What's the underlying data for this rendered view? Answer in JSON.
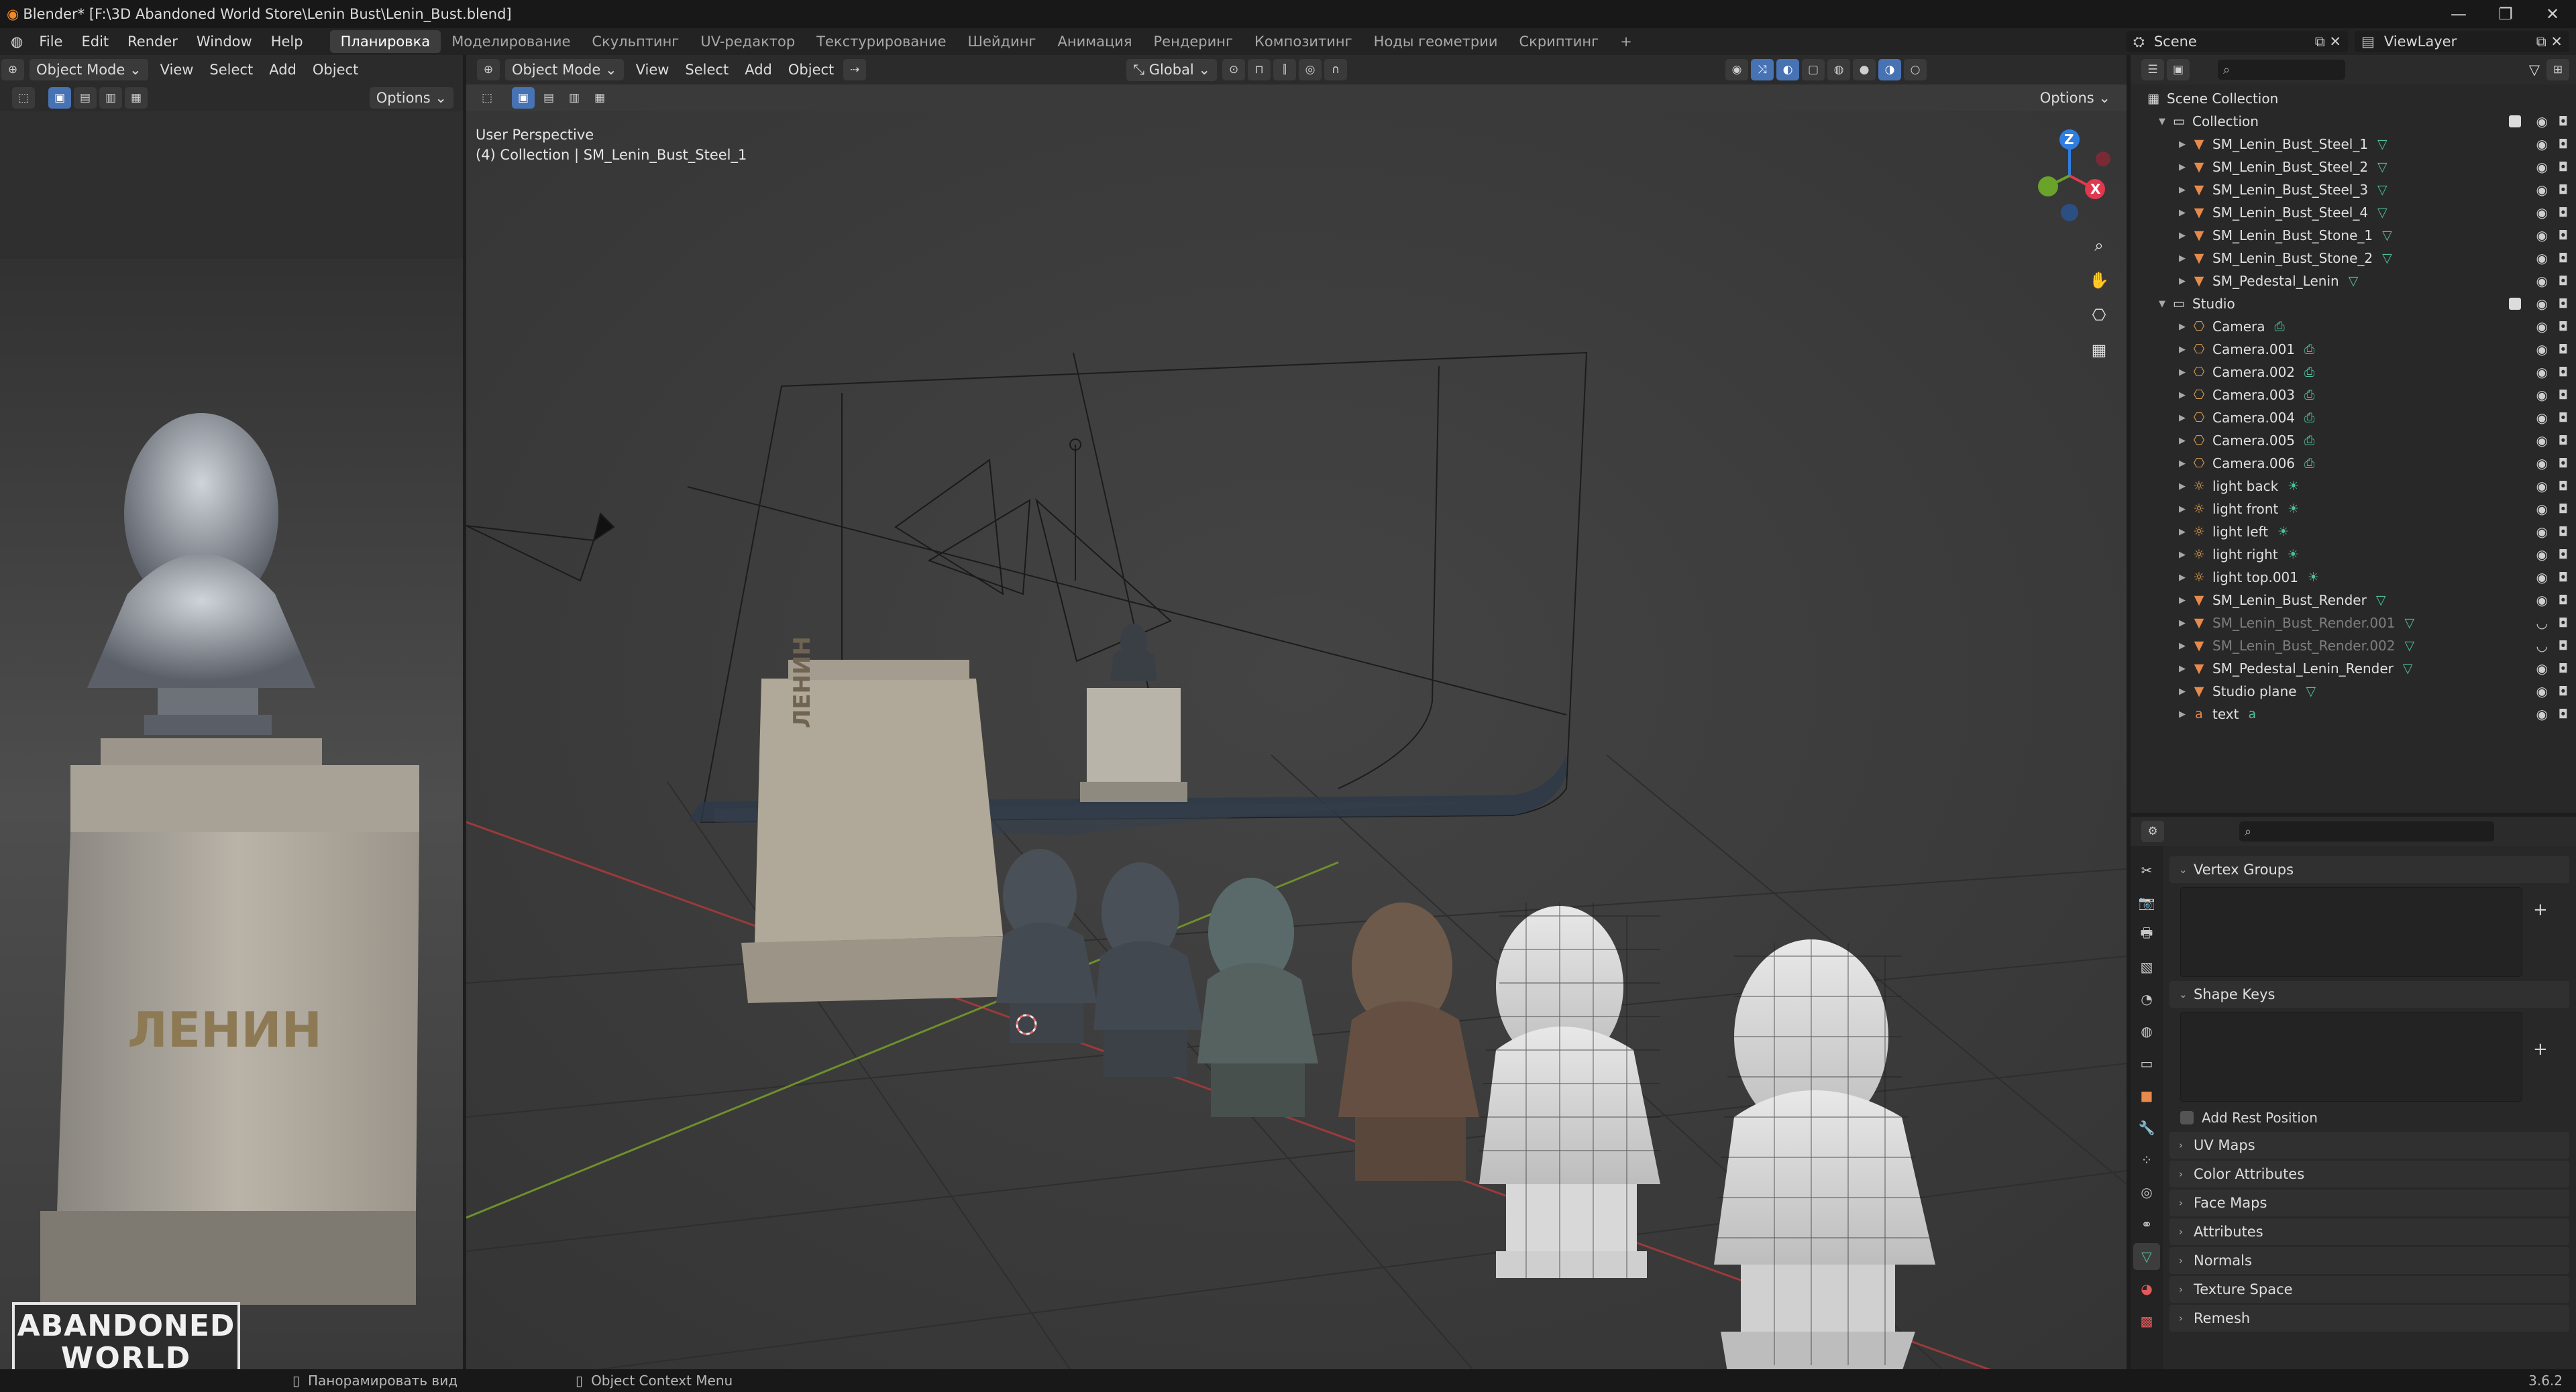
{
  "window": {
    "title": "Blender* [F:\\3D Abandoned World Store\\Lenin Bust\\Lenin_Bust.blend]",
    "controls": [
      "—",
      "❐",
      "✕"
    ]
  },
  "menu": {
    "items": [
      "File",
      "Edit",
      "Render",
      "Window",
      "Help"
    ],
    "workspaces": [
      "Планировка",
      "Моделирование",
      "Скульптинг",
      "UV-редактор",
      "Текстурирование",
      "Шейдинг",
      "Анимация",
      "Рендеринг",
      "Композитинг",
      "Ноды геометрии",
      "Скриптинг"
    ],
    "active_workspace": "Планировка",
    "add_workspace": "+",
    "scene_label": "Scene",
    "viewlayer_label": "ViewLayer"
  },
  "left_editor": {
    "mode": "Object Mode",
    "menus": [
      "View",
      "Select",
      "Add",
      "Object"
    ],
    "options": "Options",
    "pedestal_text": "ЛЕНИН",
    "logo_line1": "ABANDONED",
    "logo_line2": "WORLD"
  },
  "viewport": {
    "mode": "Object Mode",
    "menus": [
      "View",
      "Select",
      "Add",
      "Object"
    ],
    "orientation": "Global",
    "options": "Options",
    "info_line1": "User Perspective",
    "info_line2": "(4) Collection | SM_Lenin_Bust_Steel_1",
    "gizmo_z": "Z",
    "gizmo_x": "X",
    "pedestal_text": "ЛЕНИН"
  },
  "outliner": {
    "root": "Scene Collection",
    "collections": [
      {
        "name": "Collection",
        "items": [
          {
            "name": "SM_Lenin_Bust_Steel_1",
            "type": "mesh"
          },
          {
            "name": "SM_Lenin_Bust_Steel_2",
            "type": "mesh"
          },
          {
            "name": "SM_Lenin_Bust_Steel_3",
            "type": "mesh"
          },
          {
            "name": "SM_Lenin_Bust_Steel_4",
            "type": "mesh"
          },
          {
            "name": "SM_Lenin_Bust_Stone_1",
            "type": "mesh"
          },
          {
            "name": "SM_Lenin_Bust_Stone_2",
            "type": "mesh"
          },
          {
            "name": "SM_Pedestal_Lenin",
            "type": "mesh"
          }
        ]
      },
      {
        "name": "Studio",
        "items": [
          {
            "name": "Camera",
            "type": "camera"
          },
          {
            "name": "Camera.001",
            "type": "camera"
          },
          {
            "name": "Camera.002",
            "type": "camera"
          },
          {
            "name": "Camera.003",
            "type": "camera"
          },
          {
            "name": "Camera.004",
            "type": "camera"
          },
          {
            "name": "Camera.005",
            "type": "camera"
          },
          {
            "name": "Camera.006",
            "type": "camera"
          },
          {
            "name": "light back",
            "type": "light"
          },
          {
            "name": "light front",
            "type": "light"
          },
          {
            "name": "light left",
            "type": "light"
          },
          {
            "name": "light right",
            "type": "light"
          },
          {
            "name": "light top.001",
            "type": "light"
          },
          {
            "name": "SM_Lenin_Bust_Render",
            "type": "mesh"
          },
          {
            "name": "SM_Lenin_Bust_Render.001",
            "type": "mesh",
            "hidden": true
          },
          {
            "name": "SM_Lenin_Bust_Render.002",
            "type": "mesh",
            "hidden": true
          },
          {
            "name": "SM_Pedestal_Lenin_Render",
            "type": "mesh"
          },
          {
            "name": "Studio plane",
            "type": "mesh"
          },
          {
            "name": "text",
            "type": "text"
          }
        ]
      }
    ]
  },
  "properties": {
    "sections": {
      "vertex_groups": "Vertex Groups",
      "shape_keys": "Shape Keys",
      "add_rest_position": "Add Rest Position",
      "collapsed": [
        "UV Maps",
        "Color Attributes",
        "Face Maps",
        "Attributes",
        "Normals",
        "Texture Space",
        "Remesh"
      ]
    }
  },
  "status": {
    "pan_view": "Панорамировать вид",
    "context_menu": "Object Context Menu",
    "version": "3.6.2"
  },
  "colors": {
    "accent": "#4772b3",
    "mesh_icon": "#e88a4b",
    "data_icon": "#4fbf9f",
    "axis_x": "#e0394e",
    "axis_y": "#6aa329",
    "axis_z": "#2f7de1"
  }
}
